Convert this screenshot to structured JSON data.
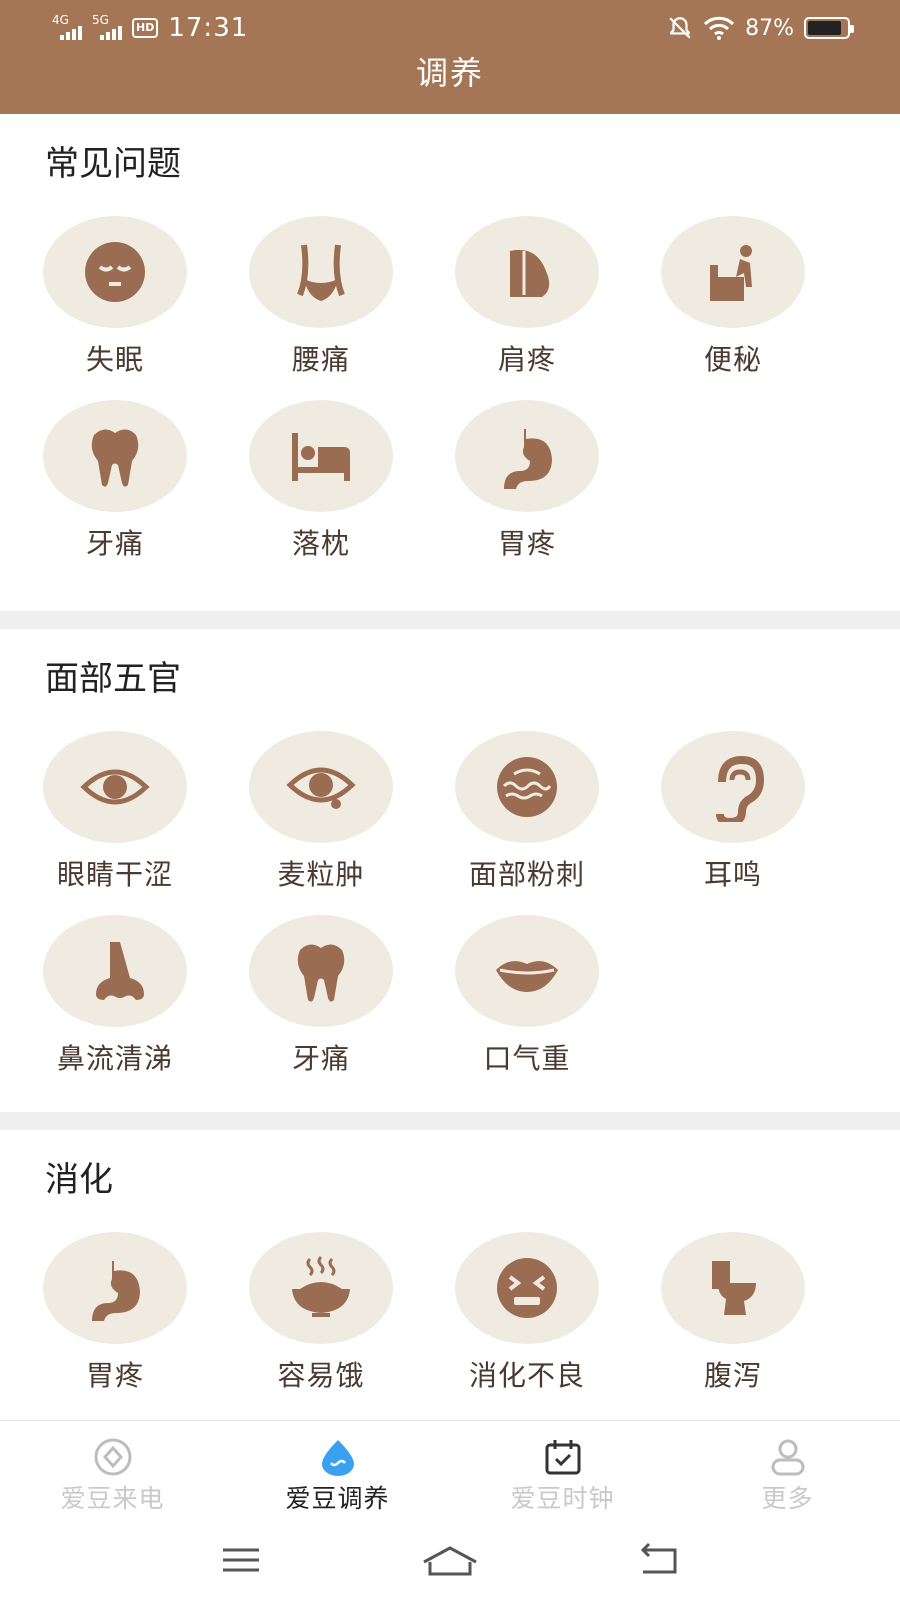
{
  "status_bar": {
    "signal_1": "4G",
    "signal_2": "5G",
    "hd_badge": "HD",
    "time": "17:31",
    "battery_percent": "87%",
    "battery_level": 0.87
  },
  "header": {
    "title": "调养"
  },
  "colors": {
    "header_bg": "#a57656",
    "icon_bg": "#f0ebe0",
    "icon_fg": "#9a6c52",
    "active_nav": "#3aa0f0"
  },
  "sections": [
    {
      "title": "常见问题",
      "items": [
        {
          "label": "失眠",
          "icon": "sleeping-face-icon"
        },
        {
          "label": "腰痛",
          "icon": "waist-icon"
        },
        {
          "label": "肩疼",
          "icon": "shoulder-icon"
        },
        {
          "label": "便秘",
          "icon": "toilet-person-icon"
        },
        {
          "label": "牙痛",
          "icon": "tooth-icon"
        },
        {
          "label": "落枕",
          "icon": "bed-icon"
        },
        {
          "label": "胃疼",
          "icon": "stomach-icon"
        }
      ]
    },
    {
      "title": "面部五官",
      "items": [
        {
          "label": "眼睛干涩",
          "icon": "eye-icon"
        },
        {
          "label": "麦粒肿",
          "icon": "eye-stye-icon"
        },
        {
          "label": "面部粉刺",
          "icon": "face-acne-icon"
        },
        {
          "label": "耳鸣",
          "icon": "ear-icon"
        },
        {
          "label": "鼻流清涕",
          "icon": "nose-icon"
        },
        {
          "label": "牙痛",
          "icon": "tooth-icon"
        },
        {
          "label": "口气重",
          "icon": "lips-icon"
        }
      ]
    },
    {
      "title": "消化",
      "items": [
        {
          "label": "胃疼",
          "icon": "stomach-icon"
        },
        {
          "label": "容易饿",
          "icon": "food-bowl-icon"
        },
        {
          "label": "消化不良",
          "icon": "upset-face-icon"
        },
        {
          "label": "腹泻",
          "icon": "toilet-icon"
        }
      ]
    }
  ],
  "bottom_nav": [
    {
      "label": "爱豆来电",
      "icon": "phone-circle-icon",
      "active": false
    },
    {
      "label": "爱豆调养",
      "icon": "droplet-icon",
      "active": true
    },
    {
      "label": "爱豆时钟",
      "icon": "calendar-check-icon",
      "active": false
    },
    {
      "label": "更多",
      "icon": "user-icon",
      "active": false
    }
  ]
}
